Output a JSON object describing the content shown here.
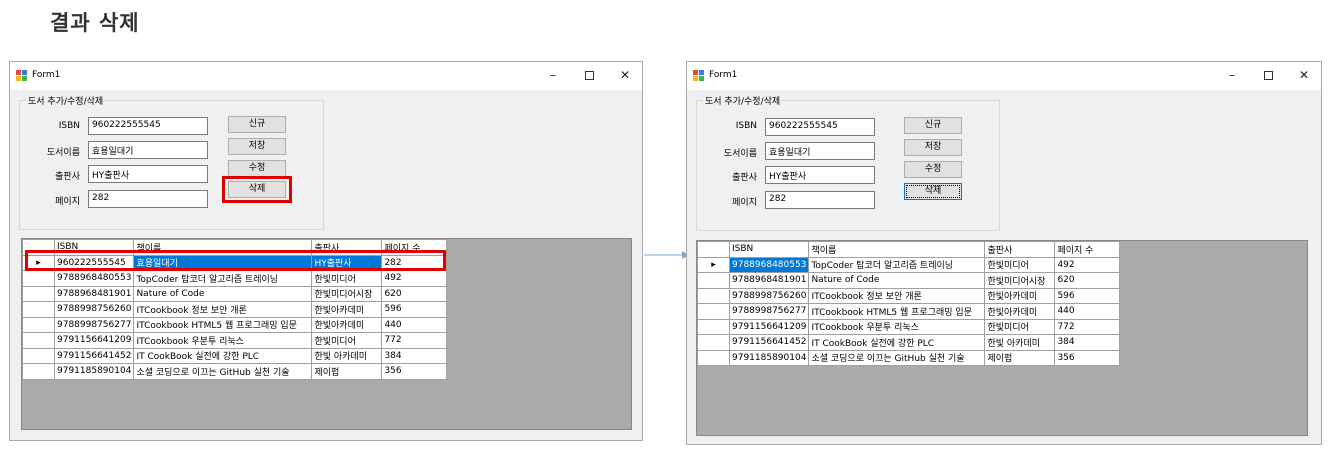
{
  "page_title": "결과 삭제",
  "colors": {
    "highlight": "#e00000",
    "selection": "#0078d7",
    "arrow": "#7fa7d4"
  },
  "window_controls": {
    "minimize": "–",
    "close": "✕"
  },
  "before": {
    "window_title": "Form1",
    "group_label": "도서 추가/수정/삭제",
    "fields": {
      "isbn": {
        "label": "ISBN",
        "value": "960222555545"
      },
      "title": {
        "label": "도서이름",
        "value": "효용일대기"
      },
      "publisher": {
        "label": "출판사",
        "value": "HY출판사"
      },
      "pages": {
        "label": "페이지",
        "value": "282"
      }
    },
    "buttons": {
      "new": "신규",
      "save": "저장",
      "edit": "수정",
      "delete": "삭제"
    },
    "columns": [
      "ISBN",
      "책이름",
      "출판사",
      "페이지 수"
    ],
    "rows": [
      [
        "960222555545",
        "효용일대기",
        "HY출판사",
        "282"
      ],
      [
        "9788968480553",
        "TopCoder 탑코더 알고리즘 트레이닝",
        "한빛미디어",
        "492"
      ],
      [
        "9788968481901",
        "Nature of Code",
        "한빛미디어시장",
        "620"
      ],
      [
        "9788998756260",
        "ITCookbook 정보 보안 개론",
        "한빛아카데미",
        "596"
      ],
      [
        "9788998756277",
        "ITCookbook HTML5 웹 프로그래밍 입문",
        "한빛아카데미",
        "440"
      ],
      [
        "9791156641209",
        "ITCookbook 우분투 리눅스",
        "한빛미디어",
        "772"
      ],
      [
        "9791156641452",
        "IT CookBook 실전에 강한 PLC",
        "한빛 아카데미",
        "384"
      ],
      [
        "9791185890104",
        "소셜 코딩으로 이끄는 GitHub 실천 기술",
        "제이펍",
        "356"
      ]
    ],
    "row_marker": "▸"
  },
  "after": {
    "window_title": "Form1",
    "group_label": "도서 추가/수정/삭제",
    "fields": {
      "isbn": {
        "label": "ISBN",
        "value": "960222555545"
      },
      "title": {
        "label": "도서이름",
        "value": "효용일대기"
      },
      "publisher": {
        "label": "출판사",
        "value": "HY출판사"
      },
      "pages": {
        "label": "페이지",
        "value": "282"
      }
    },
    "buttons": {
      "new": "신규",
      "save": "저장",
      "edit": "수정",
      "delete": "삭제"
    },
    "columns": [
      "ISBN",
      "책이름",
      "출판사",
      "페이지 수"
    ],
    "rows": [
      [
        "9788968480553",
        "TopCoder 탑코더 알고리즘 트레이닝",
        "한빛미디어",
        "492"
      ],
      [
        "9788968481901",
        "Nature of Code",
        "한빛미디어시장",
        "620"
      ],
      [
        "9788998756260",
        "ITCookbook 정보 보안 개론",
        "한빛아카데미",
        "596"
      ],
      [
        "9788998756277",
        "ITCookbook HTML5 웹 프로그래밍 입문",
        "한빛아카데미",
        "440"
      ],
      [
        "9791156641209",
        "ITCookbook 우분투 리눅스",
        "한빛미디어",
        "772"
      ],
      [
        "9791156641452",
        "IT CookBook 실전에 강한 PLC",
        "한빛 아카데미",
        "384"
      ],
      [
        "9791185890104",
        "소셜 코딩으로 이끄는 GitHub 실천 기술",
        "제이펍",
        "356"
      ]
    ],
    "row_marker": "▸"
  }
}
